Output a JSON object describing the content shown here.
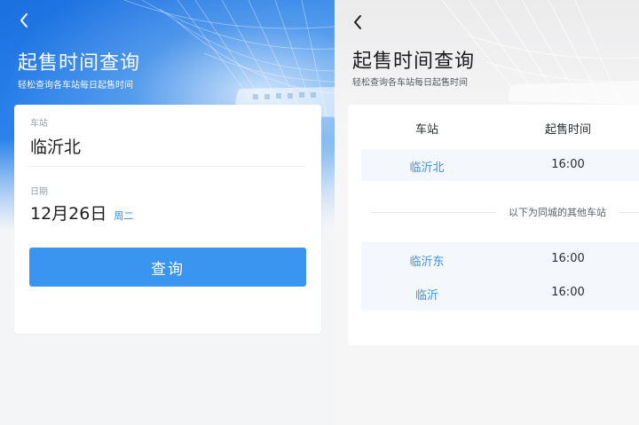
{
  "left": {
    "title": "起售时间查询",
    "subtitle": "轻松查询各车站每日起售时间",
    "station_label": "车站",
    "station_value": "临沂北",
    "date_label": "日期",
    "date_value": "12月26日",
    "weekday": "周二",
    "query_button": "查询"
  },
  "right": {
    "title": "起售时间查询",
    "subtitle": "轻松查询各车站每日起售时间",
    "table": {
      "headers": [
        "车站",
        "起售时间"
      ],
      "main_row": {
        "station": "临沂北",
        "time": "16:00"
      },
      "separator_text": "以下为同城的其他车站",
      "other_rows": [
        {
          "station": "临沂东",
          "time": "16:00"
        },
        {
          "station": "临沂",
          "time": "16:00"
        }
      ]
    }
  },
  "colors": {
    "accent": "#3a95f0",
    "link": "#3f8fe3",
    "hero_blue": "#1b6fe0"
  },
  "icons": {
    "back": "chevron-left-icon"
  }
}
